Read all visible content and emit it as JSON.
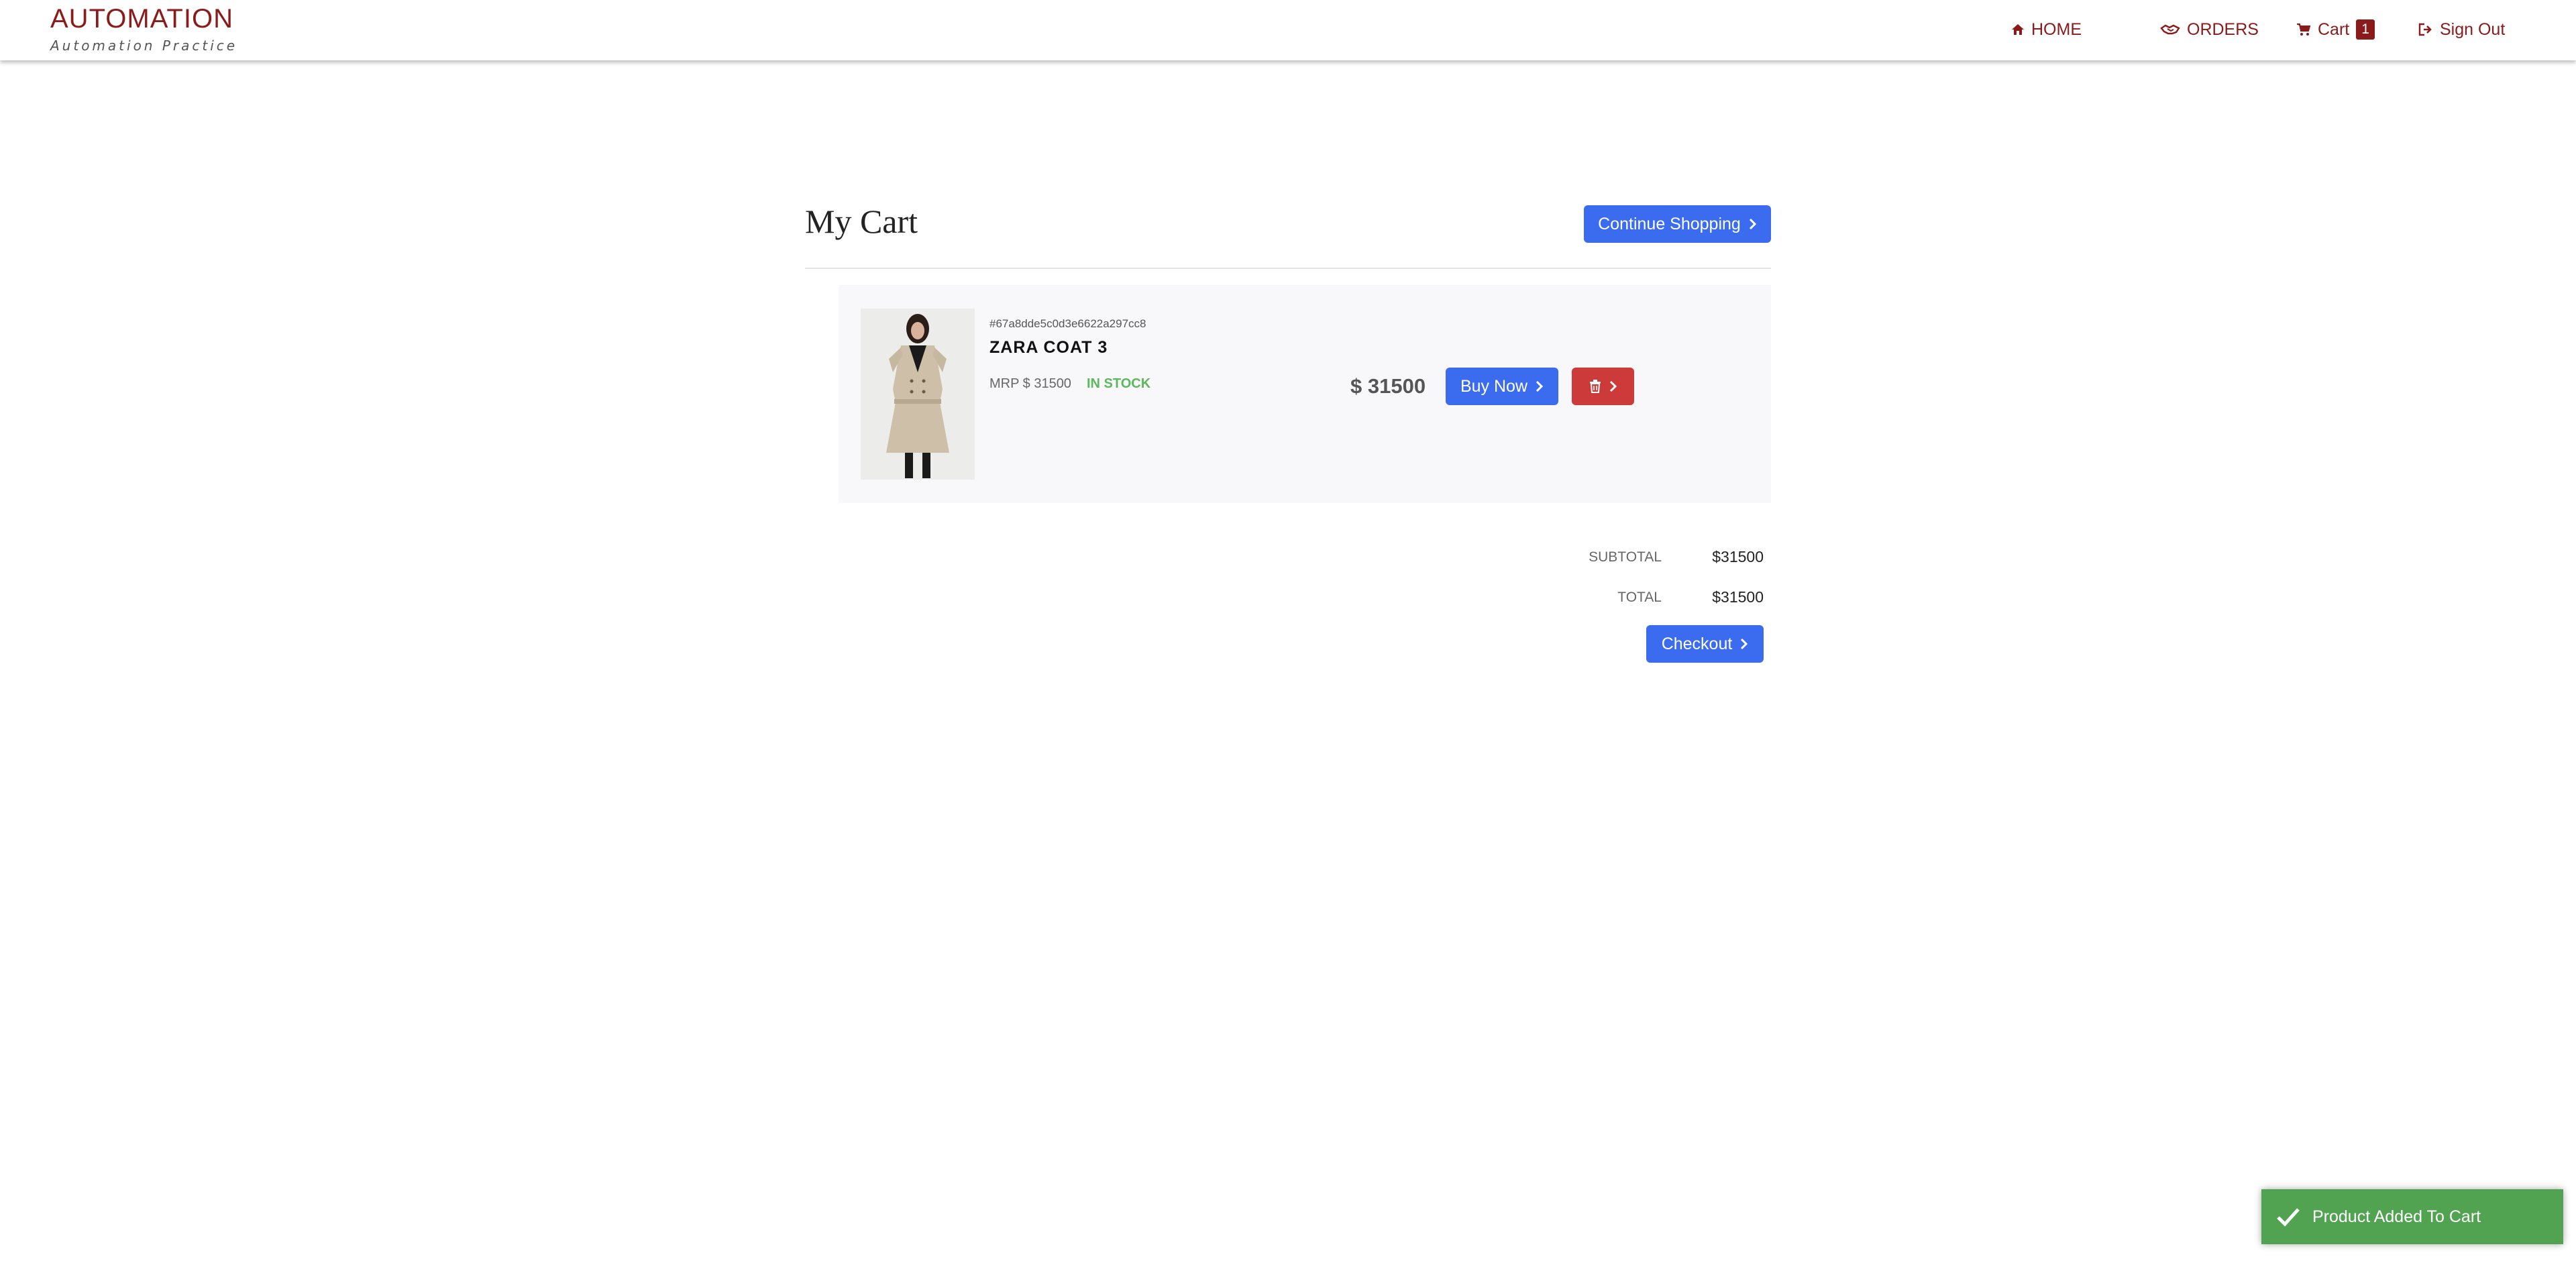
{
  "brand": {
    "title": "AUTOMATION",
    "subtitle": "Automation Practice"
  },
  "nav": {
    "home": "HOME",
    "orders": "ORDERS",
    "cart": "Cart",
    "cart_count": "1",
    "sign_out": "Sign Out"
  },
  "page": {
    "title": "My Cart",
    "continue_label": "Continue Shopping"
  },
  "item": {
    "id": "#67a8dde5c0d3e6622a297cc8",
    "name": "ZARA COAT 3",
    "mrp": "MRP $ 31500",
    "stock": "IN STOCK",
    "price": "$ 31500",
    "buy_label": "Buy Now"
  },
  "totals": {
    "subtotal_label": "SUBTOTAL",
    "subtotal_value": "$31500",
    "total_label": "TOTAL",
    "total_value": "$31500",
    "checkout_label": "Checkout"
  },
  "toast": {
    "message": "Product Added To Cart"
  },
  "colors": {
    "brand": "#8b1a1a",
    "primary": "#3b6cf0",
    "danger": "#cc3a3a",
    "success": "#5cb85c",
    "toast": "#51a351"
  }
}
